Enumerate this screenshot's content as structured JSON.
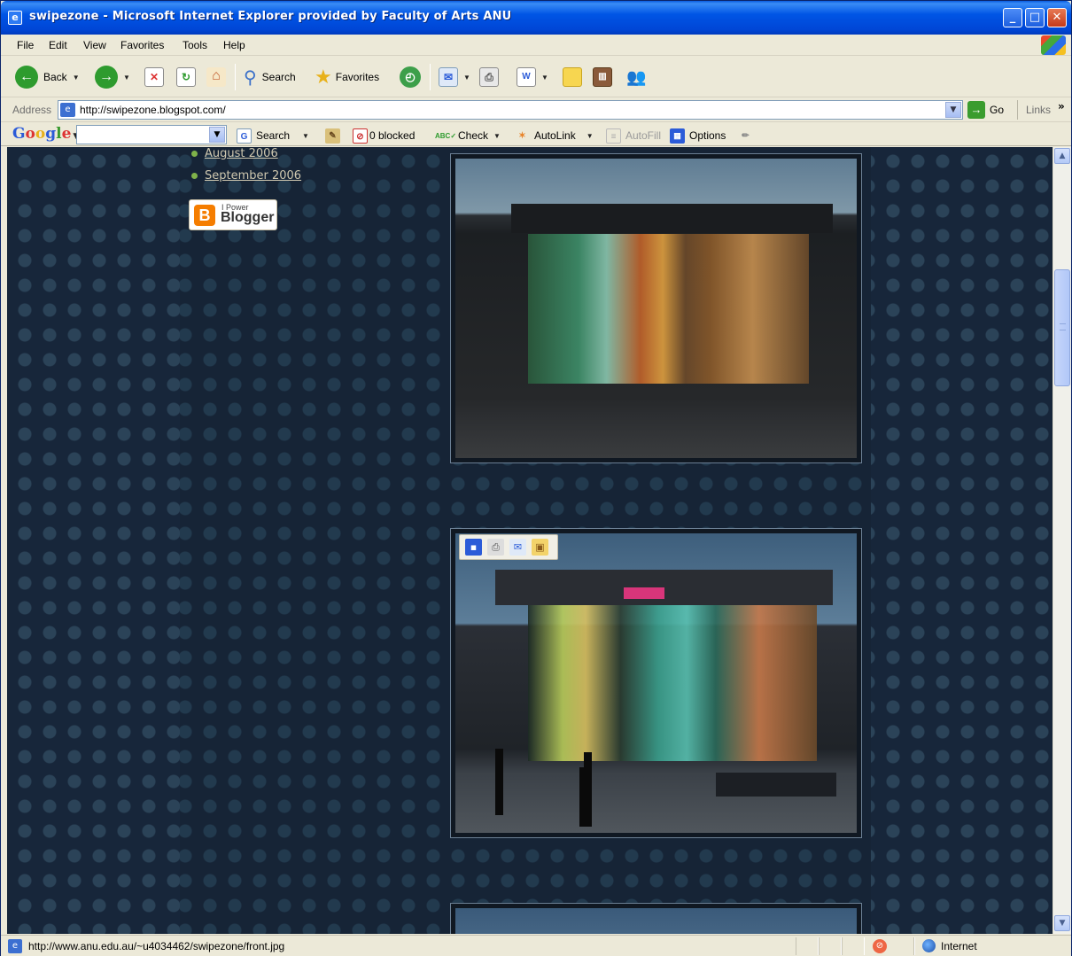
{
  "window": {
    "title": "swipezone - Microsoft Internet Explorer provided by Faculty of Arts ANU",
    "minimize": "_",
    "maximize": "□",
    "close": "✕"
  },
  "menu": [
    "File",
    "Edit",
    "View",
    "Favorites",
    "Tools",
    "Help"
  ],
  "toolbar": {
    "back": "Back",
    "search": "Search",
    "favorites": "Favorites"
  },
  "address": {
    "label": "Address",
    "url": "http://swipezone.blogspot.com/",
    "go": "Go",
    "links": "Links"
  },
  "google_toolbar": {
    "logo": "Google",
    "search": "Search",
    "blocked": "0 blocked",
    "check": "Check",
    "autolink": "AutoLink",
    "autofill": "AutoFill",
    "options": "Options"
  },
  "sidebar": {
    "archives": [
      "August 2006",
      "September 2006"
    ],
    "badge_small": "I Power",
    "badge_big": "Blogger"
  },
  "status": {
    "text": "http://www.anu.edu.au/~u4034462/swipezone/front.jpg",
    "zone": "Internet"
  },
  "colors": {
    "page_background": "#17263a",
    "link": "#cfc8b0",
    "bullet": "#7fb24a"
  }
}
